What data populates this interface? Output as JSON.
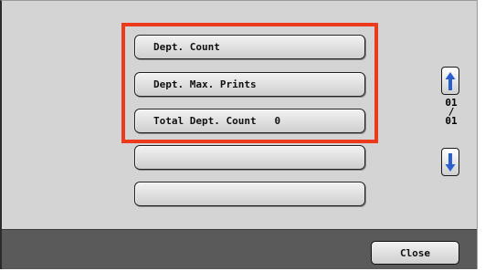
{
  "menu": {
    "items": [
      {
        "label": "Dept. Count"
      },
      {
        "label": "Dept. Max. Prints"
      },
      {
        "label": "Total Dept. Count   0"
      },
      {
        "label": ""
      },
      {
        "label": ""
      }
    ]
  },
  "pager": {
    "current": "01",
    "separator": "/",
    "total": "01"
  },
  "footer": {
    "close_label": "Close"
  },
  "colors": {
    "highlight": "#ee3a1c",
    "arrow": "#2b5fd0"
  }
}
